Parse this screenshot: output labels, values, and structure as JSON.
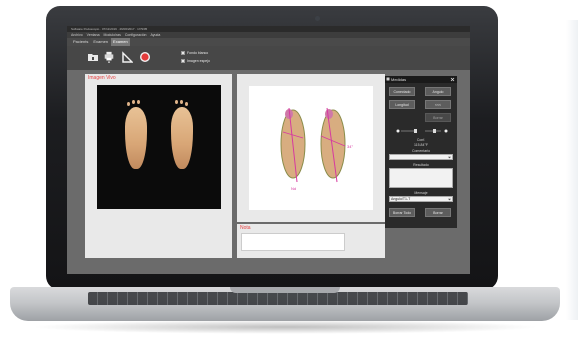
{
  "window": {
    "title": "Software Podoscopio · 07/11/2019 · 26/06/2017 · 17/9/05",
    "menus": [
      "Archivo",
      "Ventana",
      "Modulo/ras",
      "Configuración",
      "Ayuda"
    ]
  },
  "tabs": [
    {
      "label": "Pacients",
      "active": false
    },
    {
      "label": "Examen",
      "active": false
    },
    {
      "label": "Examen",
      "active": true
    }
  ],
  "toolbar": {
    "options": [
      {
        "label": "Fondo blanco",
        "checked": true
      },
      {
        "label": "Imagen espejo",
        "checked": true
      }
    ],
    "icons": [
      "folder-icon",
      "print-icon",
      "angle-icon",
      "record-icon"
    ]
  },
  "panels": {
    "live": {
      "label": "Imagen Vivo"
    },
    "notes": {
      "label": "Nota",
      "value": ""
    }
  },
  "sketch": {
    "left_foot_label": "Nd",
    "right_foot_label": "34°"
  },
  "tool_window": {
    "title": "Medidas",
    "buttons": [
      "Conectado",
      "Angulo",
      "Longitud",
      "<<<",
      "Borrar"
    ],
    "conf_label": "Conf.",
    "conf_value": "115.84°F",
    "comment_label": "Comentario",
    "result_label": "Resultado",
    "measure_label": "Mensaje",
    "measure_value": "Angulo/T1-T",
    "action_buttons": [
      "Borrar Todo",
      "Borrar"
    ]
  }
}
